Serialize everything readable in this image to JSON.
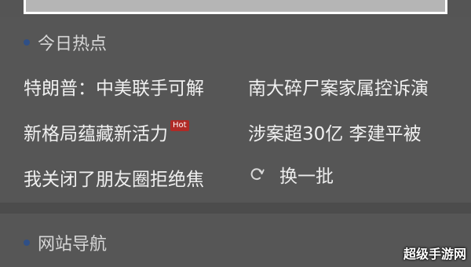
{
  "hot_section": {
    "title": "今日热点",
    "items": [
      "特朗普：中美联手可解",
      "南大碎尸案家属控诉演",
      "新格局蕴藏新活力",
      "涉案超30亿 李建平被",
      "我关闭了朋友圈拒绝焦"
    ],
    "hot_badge": "Hot",
    "refresh_label": "换一批"
  },
  "nav_section": {
    "title": "网站导航"
  },
  "watermark": "超级手游网",
  "colors": {
    "background": "#555555",
    "accent_dot": "#2f4f86",
    "hot_badge": "#b02a26"
  }
}
